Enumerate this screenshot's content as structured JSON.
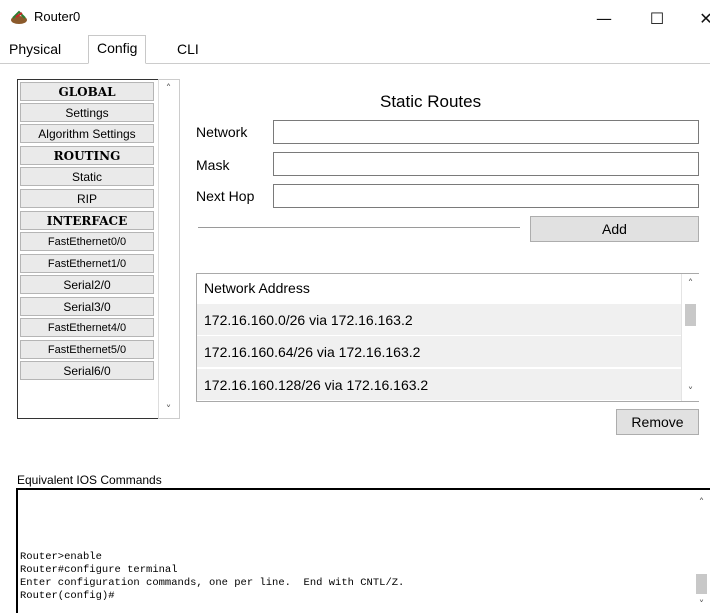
{
  "window": {
    "title": "Router0",
    "minimize": "—",
    "maximize": "☐",
    "close": "✕"
  },
  "tabs": [
    {
      "label": "Physical"
    },
    {
      "label": "Config"
    },
    {
      "label": "CLI"
    }
  ],
  "active_tab": "Config",
  "nav": {
    "items": [
      {
        "label": "GLOBAL",
        "type": "header"
      },
      {
        "label": "Settings",
        "type": "item"
      },
      {
        "label": "Algorithm Settings",
        "type": "item"
      },
      {
        "label": "ROUTING",
        "type": "header"
      },
      {
        "label": "Static",
        "type": "item"
      },
      {
        "label": "RIP",
        "type": "item"
      },
      {
        "label": "INTERFACE",
        "type": "header"
      },
      {
        "label": "FastEthernet0/0",
        "type": "item"
      },
      {
        "label": "FastEthernet1/0",
        "type": "item"
      },
      {
        "label": "Serial2/0",
        "type": "item"
      },
      {
        "label": "Serial3/0",
        "type": "item"
      },
      {
        "label": "FastEthernet4/0",
        "type": "item"
      },
      {
        "label": "FastEthernet5/0",
        "type": "item"
      },
      {
        "label": "Serial6/0",
        "type": "item"
      }
    ]
  },
  "static_routes": {
    "heading": "Static Routes",
    "network_label": "Network",
    "network_value": "",
    "mask_label": "Mask",
    "mask_value": "",
    "next_hop_label": "Next Hop",
    "next_hop_value": "",
    "add_label": "Add",
    "list_header": "Network Address",
    "routes": [
      "172.16.160.0/26 via 172.16.163.2",
      "172.16.160.64/26 via 172.16.163.2",
      "172.16.160.128/26 via 172.16.163.2"
    ],
    "remove_label": "Remove"
  },
  "ios": {
    "label": "Equivalent IOS Commands",
    "lines": [
      "Router>enable",
      "Router#configure terminal",
      "Enter configuration commands, one per line.  End with CNTL/Z.",
      "Router(config)#"
    ]
  }
}
